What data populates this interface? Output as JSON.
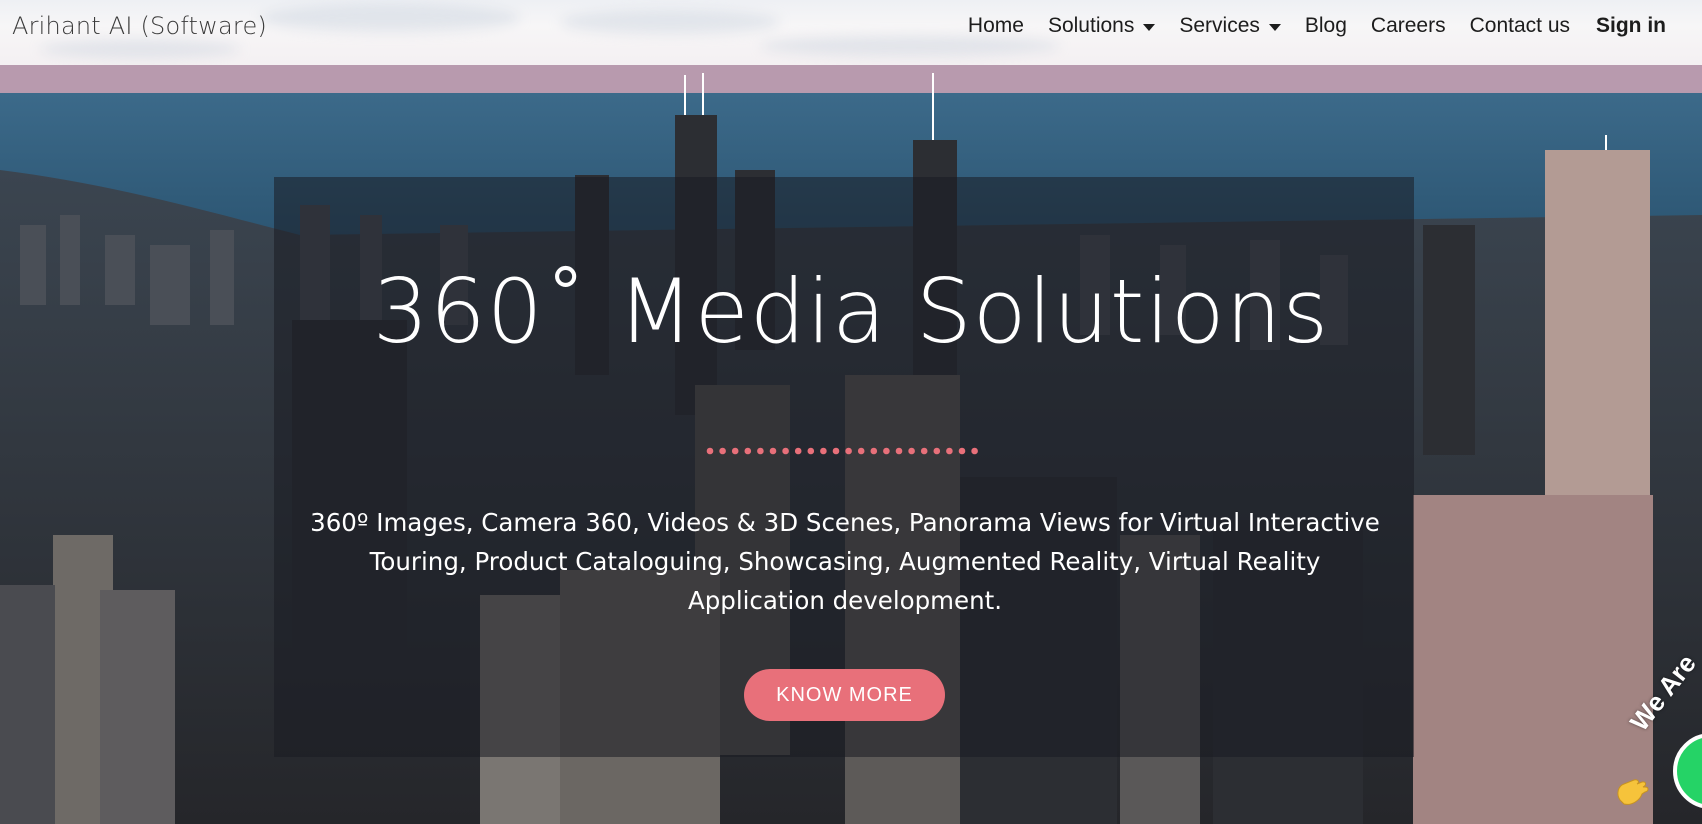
{
  "navbar": {
    "brand": "Arihant AI (Software)",
    "items": [
      {
        "label": "Home",
        "dropdown": false
      },
      {
        "label": "Solutions",
        "dropdown": true
      },
      {
        "label": "Services",
        "dropdown": true
      },
      {
        "label": "Blog",
        "dropdown": false
      },
      {
        "label": "Careers",
        "dropdown": false
      },
      {
        "label": "Contact us",
        "dropdown": false
      }
    ],
    "signin": "Sign in"
  },
  "hero": {
    "title": "360˚ Media Solutions",
    "description": "360º Images, Camera 360, Videos & 3D Scenes, Panorama Views for Virtual Interactive Touring, Product Cataloguing, Showcasing, Augmented Reality, Virtual Reality Application development.",
    "cta_label": "KNOW MORE",
    "background": "city-skyline-aerial-image"
  },
  "chat_widget": {
    "text": "We Are",
    "icon": "waving-hand-icon"
  },
  "colors": {
    "accent": "#e8707a",
    "chat_green": "#25d366",
    "text_dark": "#1d1d1d"
  }
}
